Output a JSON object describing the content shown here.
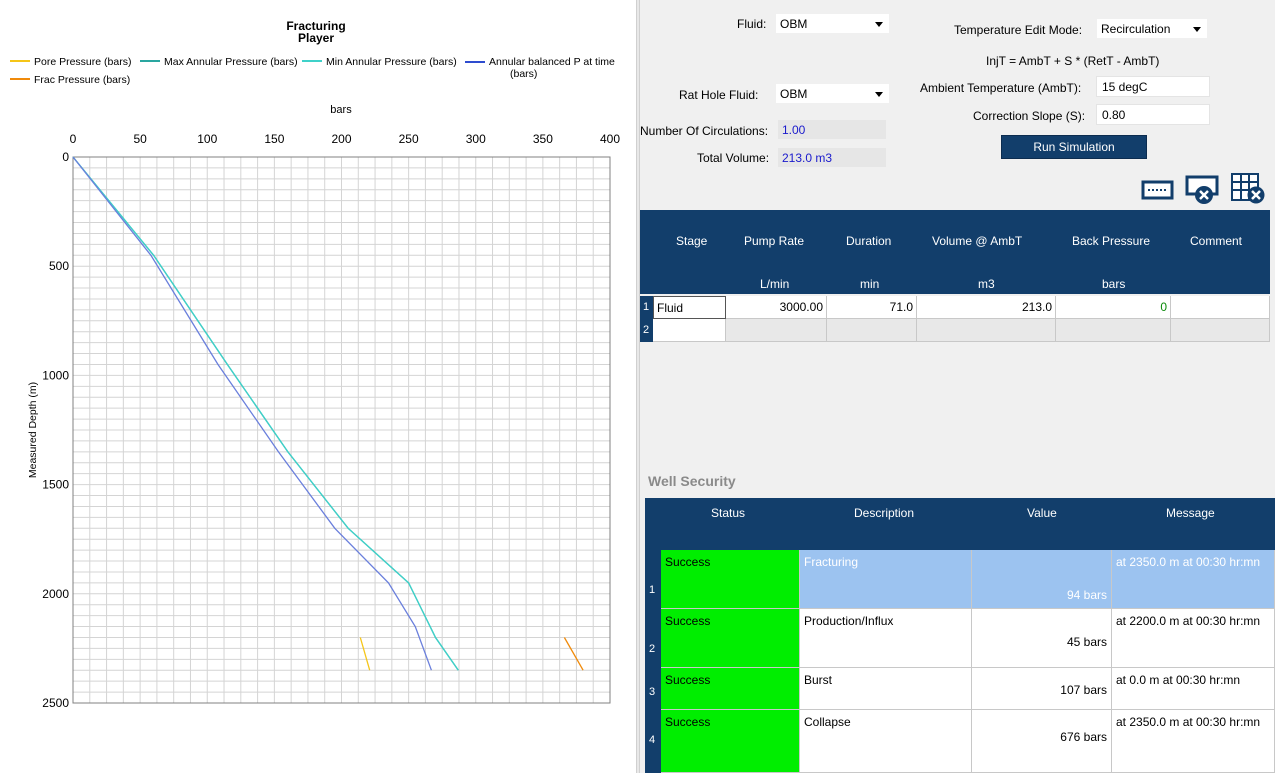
{
  "chart": {
    "title": [
      "Fracturing",
      "Player"
    ],
    "x_unit_label": "bars",
    "y_label": "Measured Depth (m)",
    "legend": [
      {
        "name": "Pore Pressure (bars)",
        "color": "#f5c518"
      },
      {
        "name": "Max Annular Pressure (bars)",
        "color": "#2aa6a0"
      },
      {
        "name": "Min Annular Pressure (bars)",
        "color": "#3fd1c9"
      },
      {
        "name": "Annular balanced P at time (bars)",
        "color": "#2e4ccf"
      },
      {
        "name": "Frac Pressure (bars)",
        "color": "#f08a0a"
      }
    ],
    "legend_extra": {
      "annular_line2": "(bars)"
    }
  },
  "chart_data": {
    "type": "line",
    "title": "Fracturing Player",
    "xlabel": "bars",
    "ylabel": "Measured Depth (m)",
    "xlim": [
      0,
      400
    ],
    "ylim": [
      2500,
      0
    ],
    "x_ticks": [
      0,
      50,
      100,
      150,
      200,
      250,
      300,
      350,
      400
    ],
    "y_ticks": [
      0,
      500,
      1000,
      1500,
      2000,
      2500
    ],
    "grid": true,
    "legend_position": "top",
    "series": [
      {
        "name": "Pore Pressure (bars)",
        "color": "#f5c518",
        "points": [
          [
            214,
            2200
          ],
          [
            221,
            2350
          ]
        ]
      },
      {
        "name": "Max Annular Pressure (bars)",
        "color": "#2aa6a0",
        "points": [
          [
            0,
            0
          ],
          [
            60,
            450
          ],
          [
            115,
            950
          ],
          [
            160,
            1350
          ],
          [
            205,
            1700
          ],
          [
            250,
            1950
          ],
          [
            270,
            2200
          ],
          [
            287,
            2350
          ]
        ]
      },
      {
        "name": "Min Annular Pressure (bars)",
        "color": "#3fd1c9",
        "points": [
          [
            0,
            0
          ],
          [
            60,
            450
          ],
          [
            115,
            950
          ],
          [
            160,
            1350
          ],
          [
            205,
            1700
          ],
          [
            250,
            1950
          ],
          [
            270,
            2200
          ],
          [
            287,
            2350
          ]
        ]
      },
      {
        "name": "Annular balanced P at time (bars)",
        "color": "#6a7fdc",
        "points": [
          [
            0,
            0
          ],
          [
            58,
            450
          ],
          [
            108,
            950
          ],
          [
            153,
            1350
          ],
          [
            195,
            1700
          ],
          [
            235,
            1950
          ],
          [
            255,
            2150
          ],
          [
            267,
            2350
          ]
        ]
      },
      {
        "name": "Frac Pressure (bars)",
        "color": "#f08a0a",
        "points": [
          [
            366,
            2200
          ],
          [
            380,
            2350
          ]
        ]
      }
    ]
  },
  "controls": {
    "fluid_label": "Fluid:",
    "fluid_value": "OBM",
    "rathole_label": "Rat Hole Fluid:",
    "rathole_value": "OBM",
    "circulations_label": "Number Of Circulations:",
    "circulations_value": "1.00",
    "total_volume_label": "Total Volume:",
    "total_volume_value": "213.0 m3",
    "temp_mode_label": "Temperature Edit Mode:",
    "temp_mode_value": "Recirculation",
    "formula": "InjT = AmbT + S * (RetT - AmbT)",
    "ambient_label": "Ambient Temperature (AmbT):",
    "ambient_value": "15 degC",
    "slope_label": "Correction Slope (S):",
    "slope_value": "0.80",
    "run_label": "Run Simulation"
  },
  "stage_table": {
    "headers": [
      "Stage",
      "Pump Rate",
      "Duration",
      "Volume @ AmbT",
      "Back Pressure",
      "Comment"
    ],
    "units": [
      "",
      "L/min",
      "min",
      "m3",
      "bars",
      ""
    ],
    "rows": [
      {
        "n": "1",
        "stage": "Fluid",
        "rate": "3000.00",
        "duration": "71.0",
        "volume": "213.0",
        "back": "0",
        "comment": ""
      },
      {
        "n": "2",
        "stage": "",
        "rate": "",
        "duration": "",
        "volume": "",
        "back": "",
        "comment": ""
      }
    ]
  },
  "well_security": {
    "title": "Well Security",
    "headers": [
      "Status",
      "Description",
      "Value",
      "Message"
    ],
    "rows": [
      {
        "n": "1",
        "status": "Success",
        "description": "Fracturing",
        "value": "94 bars",
        "message": "at 2350.0 m at 00:30 hr:mn"
      },
      {
        "n": "2",
        "status": "Success",
        "description": "Production/Influx",
        "value": "45 bars",
        "message": "at 2200.0 m at 00:30 hr:mn"
      },
      {
        "n": "3",
        "status": "Success",
        "description": "Burst",
        "value": "107 bars",
        "message": "at 0.0 m at 00:30 hr:mn"
      },
      {
        "n": "4",
        "status": "Success",
        "description": "Collapse",
        "value": "676 bars",
        "message": "at 2350.0 m at 00:30 hr:mn"
      }
    ]
  },
  "colors": {
    "header_bg": "#123e6b",
    "success_bg": "#00ee00",
    "selected_row_bg": "#9cc3f0"
  },
  "icons": [
    "add-row-icon",
    "delete-row-icon",
    "delete-table-icon"
  ]
}
